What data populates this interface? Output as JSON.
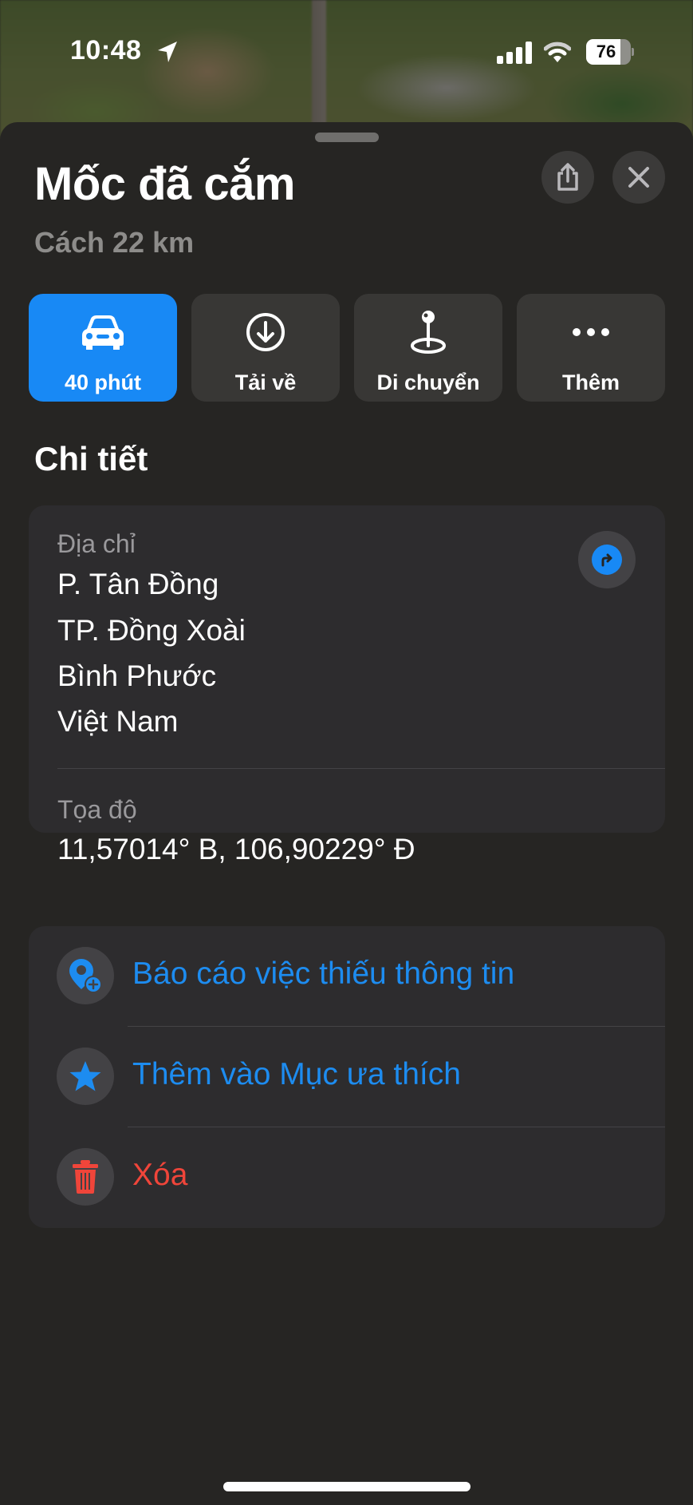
{
  "status_bar": {
    "time": "10:48",
    "location_icon": "location-arrow-icon",
    "signal_icon": "cellular-signal-icon",
    "wifi_icon": "wifi-icon",
    "battery_level": 76,
    "battery_text": "76"
  },
  "sheet": {
    "title": "Mốc đã cắm",
    "subtitle": "Cách 22 km",
    "share_icon": "share-icon",
    "close_icon": "close-icon"
  },
  "actions": [
    {
      "label": "40 phút",
      "icon": "car-icon",
      "primary": true
    },
    {
      "label": "Tải về",
      "icon": "download-circle-icon",
      "primary": false
    },
    {
      "label": "Di chuyển",
      "icon": "move-pin-icon",
      "primary": false
    },
    {
      "label": "Thêm",
      "icon": "more-ellipsis-icon",
      "primary": false
    }
  ],
  "details": {
    "section_title": "Chi tiết",
    "address_label": "Địa chỉ",
    "address_lines": [
      "P. Tân Đồng",
      "TP. Đồng Xoài",
      "Bình Phước",
      "Việt Nam"
    ],
    "directions_icon": "directions-arrow-icon",
    "coordinates_label": "Tọa độ",
    "coordinates_value": "11,57014° B, 106,90229° Đ"
  },
  "list_actions": [
    {
      "label": "Báo cáo việc thiếu thông tin",
      "icon": "report-pin-plus-icon",
      "color": "#1d8cf0"
    },
    {
      "label": "Thêm vào Mục ưa thích",
      "icon": "star-icon",
      "color": "#1d8cf0"
    },
    {
      "label": "Xóa",
      "icon": "trash-icon",
      "color": "#f0453a"
    }
  ],
  "colors": {
    "accent": "#1889f5",
    "link": "#1d8cf0",
    "danger": "#f0453a",
    "sheet_bg": "#262523",
    "card_bg": "#2d2c2e"
  }
}
